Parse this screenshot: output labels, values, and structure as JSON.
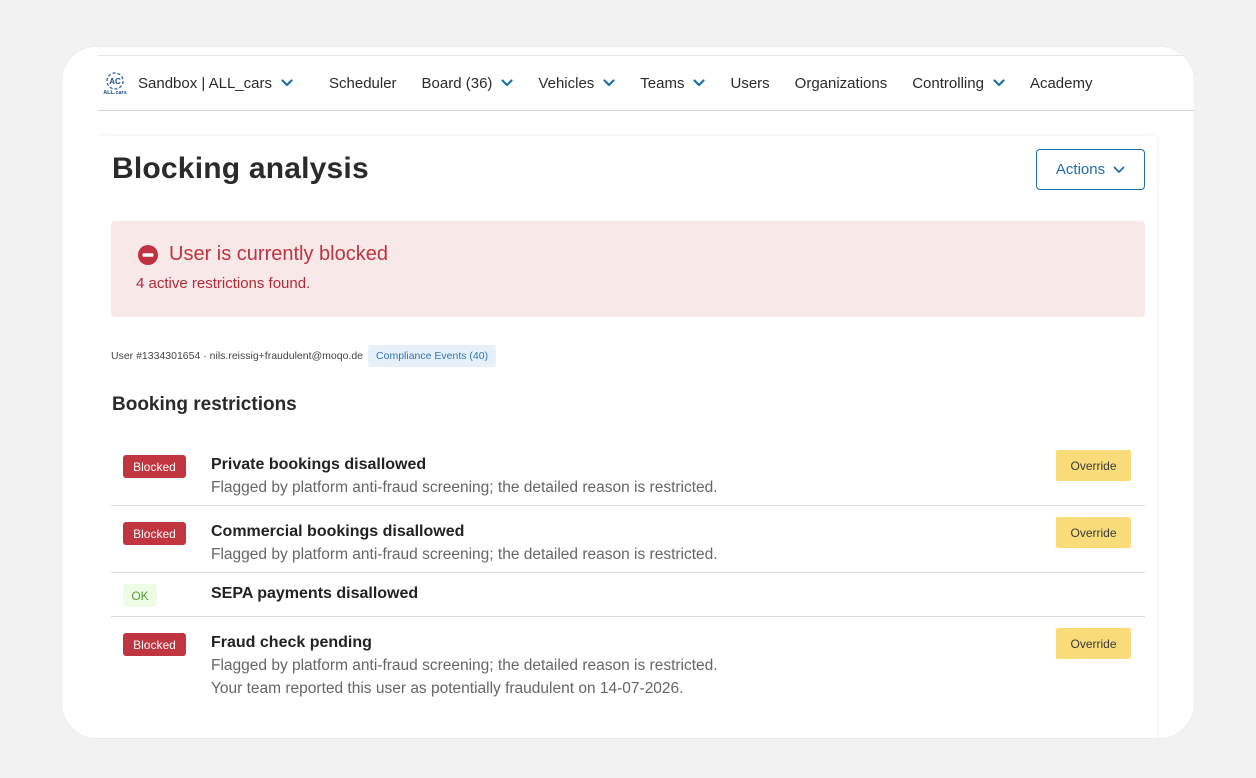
{
  "nav": {
    "brand": "Sandbox | ALL_cars",
    "items": [
      {
        "label": "Scheduler",
        "dropdown": false
      },
      {
        "label": "Board (36)",
        "dropdown": true
      },
      {
        "label": "Vehicles",
        "dropdown": true
      },
      {
        "label": "Teams",
        "dropdown": true
      },
      {
        "label": "Users",
        "dropdown": false
      },
      {
        "label": "Organizations",
        "dropdown": false
      },
      {
        "label": "Controlling",
        "dropdown": true
      },
      {
        "label": "Academy",
        "dropdown": false
      }
    ]
  },
  "page": {
    "title": "Blocking analysis",
    "actions_label": "Actions"
  },
  "alert": {
    "title": "User is currently blocked",
    "text": "4 active restrictions found.",
    "color": "#c0323f"
  },
  "user": {
    "meta": "User #1334301654 · nils.reissig+fraudulent@moqo.de",
    "compliance_link": "Compliance Events (40)"
  },
  "section_title": "Booking restrictions",
  "restrictions": [
    {
      "status": "Blocked",
      "title": "Private bookings disallowed",
      "lines": [
        "Flagged by platform anti-fraud screening; the detailed reason is restricted."
      ],
      "override": "Override"
    },
    {
      "status": "Blocked",
      "title": "Commercial bookings disallowed",
      "lines": [
        "Flagged by platform anti-fraud screening; the detailed reason is restricted."
      ],
      "override": "Override"
    },
    {
      "status": "OK",
      "title": "SEPA payments disallowed",
      "lines": [],
      "override": ""
    },
    {
      "status": "Blocked",
      "title": "Fraud check pending",
      "lines": [
        "Flagged by platform anti-fraud screening; the detailed reason is restricted.",
        "Your team reported this user as potentially fraudulent on 14-07-2026."
      ],
      "override": "Override"
    }
  ],
  "colors": {
    "blocked": "#c0353f",
    "ok_bg": "#eefbe6",
    "override_bg": "#fadc7a",
    "link": "#1f6fa8"
  }
}
